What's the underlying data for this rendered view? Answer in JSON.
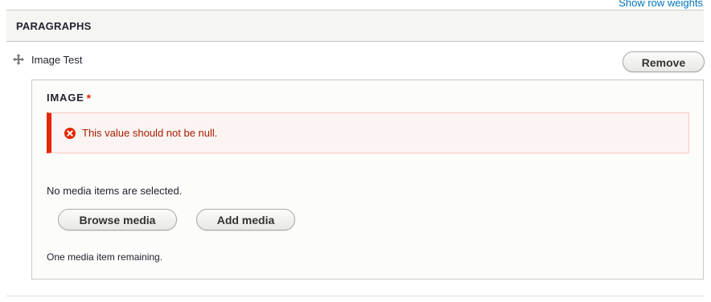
{
  "table": {
    "row_weights_link": "Show row weights",
    "header_label": "PARAGRAPHS"
  },
  "paragraph": {
    "title": "Image Test",
    "remove_label": "Remove",
    "drag_icon": "move-arrows-icon"
  },
  "field": {
    "label": "IMAGE",
    "required_marker": "*",
    "error_icon": "error-x-circle-icon",
    "error_message": "This value should not be null.",
    "empty_message": "No media items are selected.",
    "browse_label": "Browse media",
    "add_label": "Add media",
    "remaining_message": "One media item remaining."
  },
  "colors": {
    "link": "#0074bd",
    "error_accent": "#e62600",
    "error_text": "#a51b00",
    "error_bg": "#fcf4f2",
    "header_bg": "#f5f5f2"
  }
}
